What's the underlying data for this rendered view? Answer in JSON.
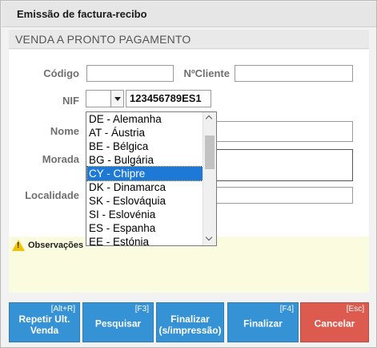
{
  "window": {
    "title": "Emissão de factura-recibo"
  },
  "section": {
    "title": "VENDA A PRONTO PAGAMENTO"
  },
  "form": {
    "codigo_label": "Código",
    "codigo_value": "",
    "ncliente_label": "NºCliente",
    "ncliente_value": "",
    "nif_label": "NIF",
    "nif_country": "",
    "nif_value": "123456789ES1",
    "nome_label": "Nome",
    "nome_value": "",
    "morada_label": "Morada",
    "morada_value": "",
    "localidade_label": "Localidade",
    "localidade_value": ""
  },
  "dropdown": {
    "options": [
      "DE - Alemanha",
      "AT - Áustria",
      "BE - Bélgica",
      "BG - Bulgária",
      "CY - Chipre",
      "DK - Dinamarca",
      "SK - Eslováquia",
      "SI - Eslovénia",
      "ES - Espanha",
      "EE - Estónia"
    ],
    "selected": "CY - Chipre"
  },
  "observacoes": {
    "label": "Observações"
  },
  "buttons": {
    "repetir": {
      "key": "[Alt+R]",
      "label": "Repetir Ult. Venda"
    },
    "pesquisar": {
      "key": "[F3]",
      "label": "Pesquisar"
    },
    "finalizar_sem": {
      "key": "",
      "label": "Finalizar (s/impressão)"
    },
    "finalizar": {
      "key": "[F4]",
      "label": "Finalizar"
    },
    "cancelar": {
      "key": "[Esc]",
      "label": "Cancelar"
    }
  },
  "colors": {
    "button_blue": "#3592d4",
    "button_red": "#dd5a4f",
    "selection": "#1e78d6",
    "notes_bg": "#fbfbe0"
  }
}
